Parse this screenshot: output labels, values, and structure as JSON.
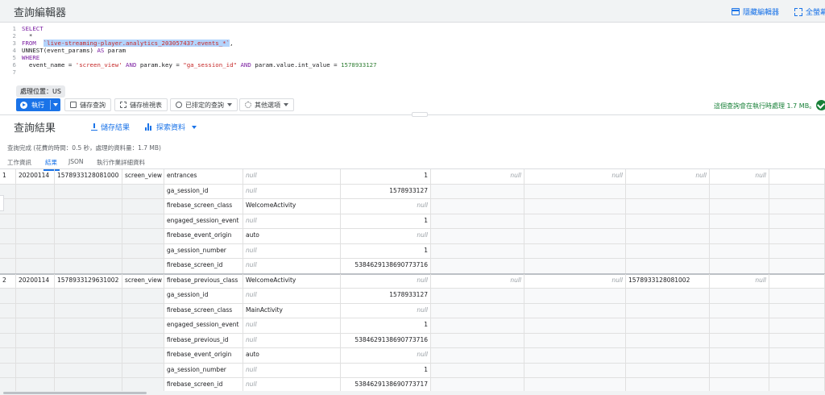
{
  "app": {
    "editor_title": "查詢編輯器",
    "hide_editor": "隱藏編輯器",
    "fullscreen": "全螢幕"
  },
  "editor": {
    "lines": [
      {
        "n": "1",
        "parts": [
          {
            "t": "SELECT",
            "c": "kw"
          }
        ]
      },
      {
        "n": "2",
        "parts": [
          {
            "t": "  *",
            "c": ""
          }
        ]
      },
      {
        "n": "3",
        "parts": [
          {
            "t": "FROM  ",
            "c": "kw"
          },
          {
            "t": "`live-streaming-player.analytics_203057437.events_*`",
            "c": "hl"
          },
          {
            "t": ",",
            "c": ""
          }
        ]
      },
      {
        "n": "4",
        "parts": [
          {
            "t": "UNNEST(event_params) ",
            "c": ""
          },
          {
            "t": "AS",
            "c": "kw"
          },
          {
            "t": " param",
            "c": ""
          }
        ]
      },
      {
        "n": "5",
        "parts": [
          {
            "t": "WHERE",
            "c": "kw"
          }
        ]
      },
      {
        "n": "6",
        "parts": [
          {
            "t": "  event_name = ",
            "c": ""
          },
          {
            "t": "'screen_view'",
            "c": "str"
          },
          {
            "t": " AND ",
            "c": "kw"
          },
          {
            "t": "param.key = ",
            "c": ""
          },
          {
            "t": "\"ga_session_id\"",
            "c": "str"
          },
          {
            "t": " AND ",
            "c": "kw"
          },
          {
            "t": "param.value.int_value = ",
            "c": ""
          },
          {
            "t": "1578933127",
            "c": "num"
          }
        ]
      },
      {
        "n": "7",
        "parts": []
      }
    ]
  },
  "location_badge": "處理位置：US",
  "toolbar": {
    "run": "執行",
    "save_query": "儲存查詢",
    "save_view": "儲存檢視表",
    "scheduled_query": "已排定的查詢",
    "more_options": "其他選項",
    "status": "這個查詢會在執行時處理 1.7 MB。"
  },
  "results": {
    "title": "查詢結果",
    "save_results": "儲存結果",
    "explore_data": "探索資料",
    "summary": "查詢完成 (花費的時間：0.5 秒，處理的資料量：1.7 MB)",
    "tabs": [
      "工作資訊",
      "結果",
      "JSON",
      "執行作業詳細資料"
    ],
    "null_text": "null",
    "records": [
      {
        "row": "1",
        "date": "20200114",
        "ts": "1578933128081000",
        "event": "screen_view",
        "params": [
          {
            "key": "entrances",
            "s": null,
            "i": "1",
            "tail": [
              "null",
              "null",
              "null",
              "null"
            ]
          },
          {
            "key": "ga_session_id",
            "s": null,
            "i": "1578933127"
          },
          {
            "key": "firebase_screen_class",
            "s": "WelcomeActivity",
            "i": null
          },
          {
            "key": "engaged_session_event",
            "s": null,
            "i": "1"
          },
          {
            "key": "firebase_event_origin",
            "s": "auto",
            "i": null
          },
          {
            "key": "ga_session_number",
            "s": null,
            "i": "1"
          },
          {
            "key": "firebase_screen_id",
            "s": null,
            "i": "5384629138690773716"
          }
        ]
      },
      {
        "row": "2",
        "date": "20200114",
        "ts": "1578933129631002",
        "event": "screen_view",
        "params": [
          {
            "key": "firebase_previous_class",
            "s": "WelcomeActivity",
            "i": null,
            "tail": [
              "null",
              "null",
              "1578933128081002",
              "null"
            ]
          },
          {
            "key": "ga_session_id",
            "s": null,
            "i": "1578933127"
          },
          {
            "key": "firebase_screen_class",
            "s": "MainActivity",
            "i": null
          },
          {
            "key": "engaged_session_event",
            "s": null,
            "i": "1"
          },
          {
            "key": "firebase_previous_id",
            "s": null,
            "i": "5384629138690773716"
          },
          {
            "key": "firebase_event_origin",
            "s": "auto",
            "i": null
          },
          {
            "key": "ga_session_number",
            "s": null,
            "i": "1"
          },
          {
            "key": "firebase_screen_id",
            "s": null,
            "i": "5384629138690773717"
          }
        ]
      }
    ]
  }
}
